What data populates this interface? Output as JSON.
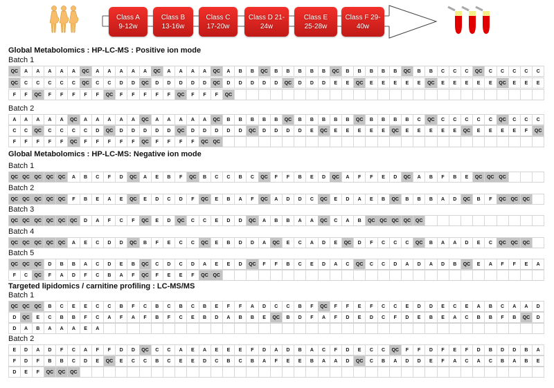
{
  "header": {
    "women_icon": "pregnant-women-icon",
    "tubes_icon": "sample-tubes-icon",
    "classes": [
      {
        "name": "Class A",
        "range": "9-12w"
      },
      {
        "name": "Class B",
        "range": "13-16w"
      },
      {
        "name": "Class C",
        "range": "17-20w"
      },
      {
        "name": "Class D 21-",
        "range": "24w"
      },
      {
        "name": "Class E",
        "range": "25-28w"
      },
      {
        "name": "Class F 29-",
        "range": "40w"
      }
    ],
    "colors": {
      "class_box": "#d8231f",
      "qc_cell": "#c4c4c4",
      "tube": "#e00000",
      "tube_cap": "#f5ef8a"
    }
  },
  "sections": [
    {
      "title": "Global Metabolomics : HP-LC-MS : Positive ion mode",
      "batches": [
        {
          "label": "Batch 1",
          "rows": [
            [
              "QC",
              "A",
              "A",
              "A",
              "A",
              "A",
              "QC",
              "A",
              "A",
              "A",
              "A",
              "A",
              "QC",
              "A",
              "A",
              "A",
              "A",
              "QC",
              "A",
              "B",
              "B",
              "QC",
              "B",
              "B",
              "B",
              "B",
              "B",
              "QC",
              "B",
              "B",
              "B",
              "B",
              "B",
              "QC",
              "B",
              "B",
              "C",
              "C",
              "C",
              "QC",
              "C",
              "C",
              "C",
              "C",
              "C"
            ],
            [
              "QC",
              "C",
              "C",
              "C",
              "C",
              "C",
              "QC",
              "C",
              "C",
              "D",
              "D",
              "QC",
              "D",
              "D",
              "D",
              "D",
              "D",
              "QC",
              "D",
              "D",
              "D",
              "D",
              "D",
              "QC",
              "D",
              "D",
              "D",
              "E",
              "E",
              "QC",
              "E",
              "E",
              "E",
              "E",
              "E",
              "QC",
              "E",
              "E",
              "E",
              "E",
              "E",
              "QC",
              "E",
              "E",
              "E"
            ],
            [
              "F",
              "F",
              "QC",
              "F",
              "F",
              "F",
              "F",
              "F",
              "QC",
              "F",
              "F",
              "F",
              "F",
              "F",
              "QC",
              "F",
              "F",
              "F",
              "QC"
            ]
          ]
        },
        {
          "label": "Batch 2",
          "rows": [
            [
              "A",
              "A",
              "A",
              "A",
              "A",
              "QC",
              "A",
              "A",
              "A",
              "A",
              "A",
              "QC",
              "A",
              "A",
              "A",
              "A",
              "A",
              "QC",
              "B",
              "B",
              "B",
              "B",
              "B",
              "QC",
              "B",
              "B",
              "B",
              "B",
              "B",
              "QC",
              "B",
              "B",
              "B",
              "B",
              "C",
              "QC",
              "C",
              "C",
              "C",
              "C",
              "C",
              "QC",
              "C",
              "C",
              "C"
            ],
            [
              "C",
              "C",
              "QC",
              "C",
              "C",
              "C",
              "C",
              "D",
              "QC",
              "D",
              "D",
              "D",
              "D",
              "D",
              "QC",
              "D",
              "D",
              "D",
              "D",
              "D",
              "QC",
              "D",
              "D",
              "D",
              "D",
              "E",
              "QC",
              "E",
              "E",
              "E",
              "E",
              "E",
              "QC",
              "E",
              "E",
              "E",
              "E",
              "E",
              "QC",
              "E",
              "E",
              "E",
              "E",
              "F",
              "QC"
            ],
            [
              "F",
              "F",
              "F",
              "F",
              "F",
              "QC",
              "F",
              "F",
              "F",
              "F",
              "F",
              "QC",
              "F",
              "F",
              "F",
              "F",
              "QC",
              "QC"
            ]
          ]
        }
      ]
    },
    {
      "title": "Global Metabolomics : HP-LC-MS: Negative ion mode",
      "batches": [
        {
          "label": "Batch 1",
          "rows": [
            [
              "QC",
              "QC",
              "QC",
              "QC",
              "QC",
              "A",
              "B",
              "C",
              "F",
              "D",
              "QC",
              "A",
              "E",
              "B",
              "F",
              "QC",
              "B",
              "C",
              "C",
              "B",
              "C",
              "QC",
              "F",
              "F",
              "B",
              "E",
              "D",
              "QC",
              "A",
              "F",
              "F",
              "E",
              "D",
              "QC",
              "A",
              "B",
              "F",
              "B",
              "E",
              "QC",
              "QC",
              "QC"
            ]
          ]
        },
        {
          "label": "Batch 2",
          "rows": [
            [
              "QC",
              "QC",
              "QC",
              "QC",
              "QC",
              "F",
              "B",
              "E",
              "A",
              "E",
              "QC",
              "E",
              "D",
              "C",
              "D",
              "F",
              "QC",
              "E",
              "B",
              "A",
              "F",
              "QC",
              "A",
              "D",
              "D",
              "C",
              "QC",
              "E",
              "D",
              "A",
              "E",
              "B",
              "QC",
              "B",
              "B",
              "B",
              "A",
              "D",
              "QC",
              "B",
              "F",
              "QC",
              "QC",
              "QC"
            ]
          ]
        },
        {
          "label": "Batch 3",
          "rows": [
            [
              "QC",
              "QC",
              "QC",
              "QC",
              "QC",
              "QC",
              "D",
              "A",
              "F",
              "C",
              "F",
              "QC",
              "E",
              "D",
              "QC",
              "C",
              "C",
              "E",
              "D",
              "D",
              "QC",
              "A",
              "B",
              "B",
              "A",
              "A",
              "QC",
              "C",
              "A",
              "B",
              "QC",
              "QC",
              "QC",
              "QC",
              "QC"
            ]
          ]
        },
        {
          "label": "Batch 4",
          "rows": [
            [
              "QC",
              "QC",
              "QC",
              "QC",
              "QC",
              "A",
              "E",
              "C",
              "D",
              "D",
              "QC",
              "B",
              "F",
              "E",
              "C",
              "C",
              "QC",
              "E",
              "B",
              "D",
              "D",
              "A",
              "QC",
              "E",
              "C",
              "A",
              "D",
              "E",
              "QC",
              "D",
              "F",
              "C",
              "C",
              "C",
              "QC",
              "B",
              "A",
              "A",
              "D",
              "E",
              "C",
              "QC",
              "QC",
              "QC"
            ]
          ]
        },
        {
          "label": "Batch 5",
          "rows": [
            [
              "QC",
              "QC",
              "QC",
              "D",
              "B",
              "B",
              "A",
              "C",
              "D",
              "E",
              "B",
              "QC",
              "C",
              "D",
              "C",
              "D",
              "A",
              "E",
              "E",
              "D",
              "QC",
              "F",
              "F",
              "B",
              "C",
              "E",
              "D",
              "A",
              "C",
              "QC",
              "C",
              "C",
              "D",
              "A",
              "D",
              "A",
              "D",
              "B",
              "QC",
              "E",
              "A",
              "F",
              "F",
              "E",
              "A"
            ],
            [
              "F",
              "C",
              "QC",
              "F",
              "A",
              "D",
              "F",
              "C",
              "B",
              "A",
              "F",
              "QC",
              "F",
              "E",
              "E",
              "F",
              "QC",
              "QC"
            ]
          ]
        }
      ]
    },
    {
      "title": "Targeted lipidomics / carnitine profiling : LC-MS/MS",
      "batches": [
        {
          "label": "Batch 1",
          "rows": [
            [
              "QC",
              "QC",
              "QC",
              "B",
              "C",
              "E",
              "E",
              "C",
              "C",
              "B",
              "F",
              "C",
              "B",
              "C",
              "B",
              "C",
              "B",
              "E",
              "F",
              "F",
              "A",
              "D",
              "C",
              "C",
              "B",
              "F",
              "QC",
              "F",
              "F",
              "E",
              "F",
              "C",
              "C",
              "E",
              "D",
              "D",
              "E",
              "C",
              "E",
              "A",
              "B",
              "C",
              "A",
              "A",
              "D",
              "A"
            ],
            [
              "D",
              "QC",
              "E",
              "C",
              "B",
              "B",
              "F",
              "C",
              "A",
              "F",
              "A",
              "F",
              "B",
              "F",
              "C",
              "E",
              "B",
              "D",
              "A",
              "B",
              "B",
              "E",
              "QC",
              "B",
              "D",
              "F",
              "A",
              "F",
              "D",
              "E",
              "D",
              "C",
              "F",
              "D",
              "E",
              "B",
              "E",
              "A",
              "C",
              "B",
              "B",
              "F",
              "B",
              "QC",
              "D"
            ],
            [
              "D",
              "A",
              "B",
              "A",
              "A",
              "A",
              "E",
              "A"
            ]
          ]
        },
        {
          "label": "Batch 2",
          "rows": [
            [
              "E",
              "D",
              "A",
              "D",
              "F",
              "C",
              "A",
              "F",
              "F",
              "D",
              "D",
              "QC",
              "C",
              "C",
              "A",
              "E",
              "A",
              "E",
              "E",
              "E",
              "F",
              "D",
              "A",
              "D",
              "B",
              "A",
              "C",
              "F",
              "D",
              "E",
              "C",
              "C",
              "QC",
              "F",
              "F",
              "D",
              "F",
              "E",
              "F",
              "D",
              "B",
              "D",
              "D",
              "B",
              "A"
            ],
            [
              "F",
              "D",
              "F",
              "B",
              "B",
              "C",
              "D",
              "E",
              "QC",
              "E",
              "C",
              "C",
              "B",
              "C",
              "E",
              "E",
              "D",
              "C",
              "B",
              "C",
              "B",
              "A",
              "F",
              "E",
              "E",
              "B",
              "A",
              "A",
              "D",
              "QC",
              "C",
              "B",
              "A",
              "D",
              "D",
              "E",
              "F",
              "A",
              "C",
              "A",
              "C",
              "B",
              "A",
              "B",
              "E"
            ],
            [
              "D",
              "E",
              "F",
              "QC",
              "QC",
              "QC"
            ]
          ]
        }
      ]
    }
  ]
}
